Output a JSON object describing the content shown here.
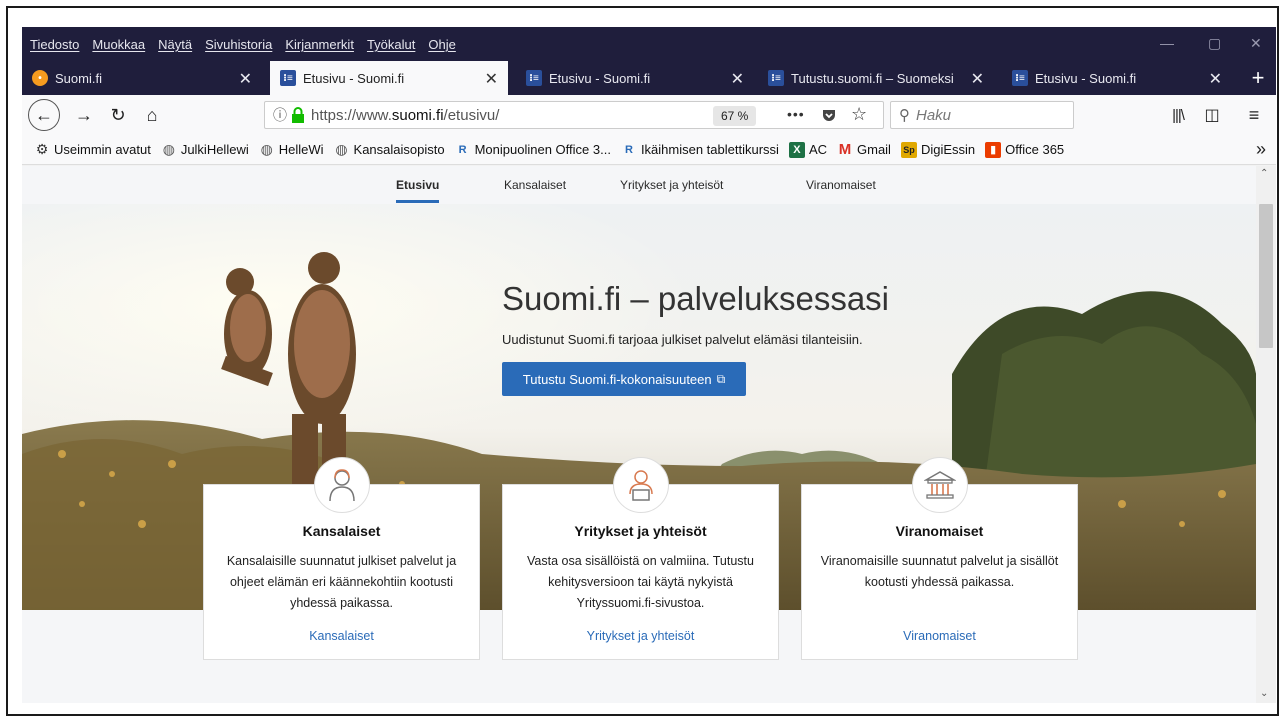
{
  "menu": [
    "Tiedosto",
    "Muokkaa",
    "Näytä",
    "Sivuhistoria",
    "Kirjanmerkit",
    "Työkalut",
    "Ohje"
  ],
  "tabs": [
    {
      "title": "Suomi.fi",
      "icon": "firefox-fox-icon",
      "active": false
    },
    {
      "title": "Etusivu - Suomi.fi",
      "icon": "suomi-fi-icon",
      "active": true
    },
    {
      "title": "Etusivu - Suomi.fi",
      "icon": "suomi-fi-icon",
      "active": false
    },
    {
      "title": "Tutustu.suomi.fi – Suomeksi",
      "icon": "suomi-fi-icon",
      "active": false
    },
    {
      "title": "Etusivu - Suomi.fi",
      "icon": "suomi-fi-icon",
      "active": false
    }
  ],
  "navbar": {
    "url_prefix": "https://www.",
    "url_domain": "suomi.fi",
    "url_path": "/etusivu/",
    "zoom": "67 %",
    "search_placeholder": "Haku",
    "more": "•••"
  },
  "bookmarks": [
    {
      "label": "Useimmin avatut",
      "icon": "gear-icon"
    },
    {
      "label": "JulkiHellewi",
      "icon": "globe-icon"
    },
    {
      "label": "HelleWi",
      "icon": "globe-icon"
    },
    {
      "label": "Kansalaisopisto",
      "icon": "globe-icon"
    },
    {
      "label": "Monipuolinen Office 3...",
      "icon": "r-icon"
    },
    {
      "label": "Ikäihmisen tablettikurssi",
      "icon": "r-icon"
    },
    {
      "label": "AC",
      "icon": "ac-icon"
    },
    {
      "label": "Gmail",
      "icon": "gmail-icon"
    },
    {
      "label": "DigiEssin",
      "icon": "sp-icon"
    },
    {
      "label": "Office 365",
      "icon": "office-icon"
    }
  ],
  "site": {
    "nav": [
      "Etusivu",
      "Kansalaiset",
      "Yritykset ja yhteisöt",
      "Viranomaiset"
    ],
    "hero_title": "Suomi.fi – palveluksessasi",
    "hero_sub": "Uudistunut Suomi.fi tarjoaa julkiset palvelut elämäsi tilanteisiin.",
    "hero_button": "Tutustu Suomi.fi-kokonaisuuteen",
    "cards": [
      {
        "title": "Kansalaiset",
        "desc": "Kansalaisille suunnatut julkiset palvelut ja ohjeet elämän eri käännekohtiin kootusti yhdessä paikassa.",
        "link": "Kansalaiset"
      },
      {
        "title": "Yritykset ja yhteisöt",
        "desc": "Vasta osa sisällöistä on valmiina. Tutustu kehitysversioon tai käytä nykyistä Yrityssuomi.fi-sivustoa.",
        "link": "Yritykset ja yhteisöt"
      },
      {
        "title": "Viranomaiset",
        "desc": "Viranomaisille suunnatut palvelut ja sisällöt kootusti yhdessä paikassa.",
        "link": "Viranomaiset"
      }
    ]
  }
}
